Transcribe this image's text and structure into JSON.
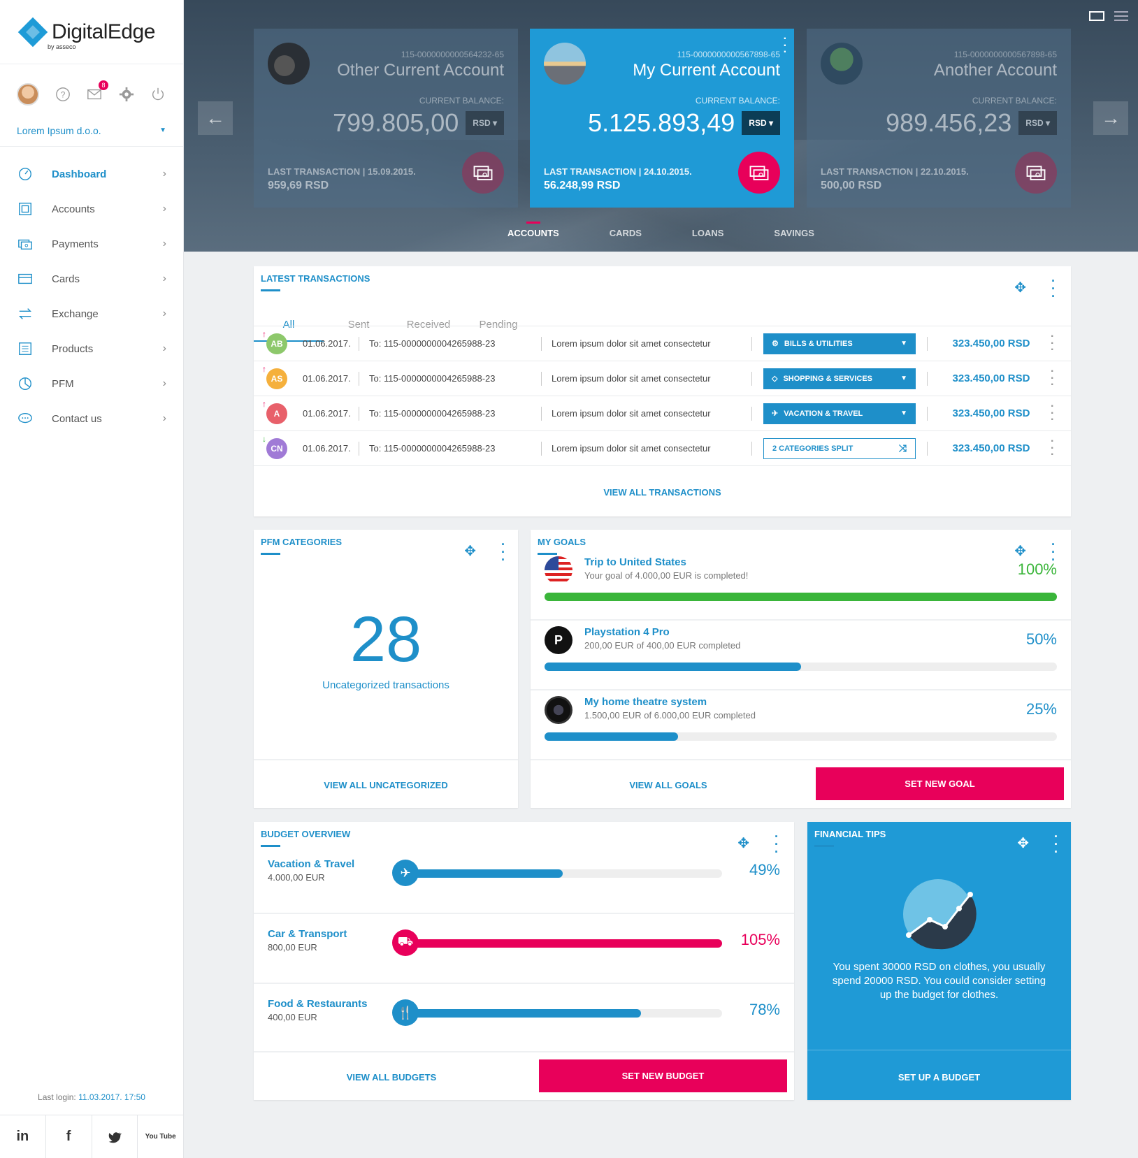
{
  "brand": {
    "name": "DigitalEdge",
    "by": "by asseco"
  },
  "user": {
    "messages_count": "8",
    "company": "Lorem Ipsum d.o.o."
  },
  "nav": [
    {
      "label": "Dashboard",
      "icon": "dashboard-icon"
    },
    {
      "label": "Accounts",
      "icon": "accounts-icon"
    },
    {
      "label": "Payments",
      "icon": "payments-icon"
    },
    {
      "label": "Cards",
      "icon": "cards-icon"
    },
    {
      "label": "Exchange",
      "icon": "exchange-icon"
    },
    {
      "label": "Products",
      "icon": "products-icon"
    },
    {
      "label": "PFM",
      "icon": "pfm-icon"
    },
    {
      "label": "Contact us",
      "icon": "contact-icon"
    }
  ],
  "last_login": {
    "label": "Last login:",
    "value": "11.03.2017. 17:50"
  },
  "social": [
    "in",
    "f",
    "t",
    "You Tube"
  ],
  "accounts": [
    {
      "number": "115-0000000000564232-65",
      "name": "Other Current Account",
      "balance_label": "CURRENT BALANCE:",
      "balance": "799.805,00",
      "currency": "RSD",
      "last_label": "LAST TRANSACTION",
      "last_date": "15.09.2015.",
      "last_amount": "959,69 RSD"
    },
    {
      "number": "115-0000000000567898-65",
      "name": "My Current Account",
      "balance_label": "CURRENT BALANCE:",
      "balance": "5.125.893,49",
      "currency": "RSD",
      "last_label": "LAST TRANSACTION",
      "last_date": "24.10.2015.",
      "last_amount": "56.248,99 RSD"
    },
    {
      "number": "115-0000000000567898-65",
      "name": "Another Account",
      "balance_label": "CURRENT BALANCE:",
      "balance": "989.456,23",
      "currency": "RSD",
      "last_label": "LAST TRANSACTION",
      "last_date": "22.10.2015.",
      "last_amount": "500,00 RSD"
    }
  ],
  "hero_tabs": [
    "ACCOUNTS",
    "CARDS",
    "LOANS",
    "SAVINGS"
  ],
  "transactions": {
    "title": "LATEST TRANSACTIONS",
    "tabs": [
      "All",
      "Sent",
      "Received",
      "Pending"
    ],
    "rows": [
      {
        "initials": "AB",
        "color": "#8dc86b",
        "dir": "↑",
        "date": "01.06.2017.",
        "to": "To: 115-0000000004265988-23",
        "desc": "Lorem ipsum dolor sit amet consectetur",
        "category": "BILLS & UTILITIES",
        "amount": "323.450,00 RSD"
      },
      {
        "initials": "AS",
        "color": "#f5b03c",
        "dir": "↑",
        "date": "01.06.2017.",
        "to": "To: 115-0000000004265988-23",
        "desc": "Lorem ipsum dolor sit amet consectetur",
        "category": "SHOPPING & SERVICES",
        "amount": "323.450,00 RSD"
      },
      {
        "initials": "A",
        "color": "#e8606a",
        "dir": "↑",
        "date": "01.06.2017.",
        "to": "To: 115-0000000004265988-23",
        "desc": "Lorem ipsum dolor sit amet consectetur",
        "category": "VACATION & TRAVEL",
        "amount": "323.450,00 RSD"
      },
      {
        "initials": "CN",
        "color": "#a07ad6",
        "dir": "↓",
        "date": "01.06.2017.",
        "to": "To: 115-0000000004265988-23",
        "desc": "Lorem ipsum dolor sit amet consectetur",
        "category": "2 CATEGORIES SPLIT",
        "amount": "323.450,00 RSD"
      }
    ],
    "view_all": "VIEW ALL TRANSACTIONS"
  },
  "pfm": {
    "title": "PFM CATEGORIES",
    "count": "28",
    "label": "Uncategorized transactions",
    "view_all": "VIEW ALL UNCATEGORIZED"
  },
  "goals": {
    "title": "MY GOALS",
    "items": [
      {
        "name": "Trip to United States",
        "sub": "Your goal of 4.000,00 EUR is completed!",
        "pct": "100%",
        "fill": 1.0,
        "color": "#3ab53a"
      },
      {
        "name": "Playstation 4 Pro",
        "sub": "200,00 EUR of 400,00 EUR completed",
        "pct": "50%",
        "fill": 0.5,
        "color": "#1e8fc9"
      },
      {
        "name": "My home theatre system",
        "sub": "1.500,00 EUR of 6.000,00 EUR completed",
        "pct": "25%",
        "fill": 0.26,
        "color": "#1e8fc9"
      }
    ],
    "view_all": "VIEW ALL GOALS",
    "set_new": "SET NEW GOAL"
  },
  "budget": {
    "title": "BUDGET OVERVIEW",
    "items": [
      {
        "name": "Vacation & Travel",
        "amount": "4.000,00 EUR",
        "pct": "49%",
        "fill": 0.49,
        "color": "#1e8fc9",
        "icon": "plane-icon"
      },
      {
        "name": "Car & Transport",
        "amount": "800,00 EUR",
        "pct": "105%",
        "fill": 1.0,
        "color": "#e8005a",
        "icon": "car-icon"
      },
      {
        "name": "Food & Restaurants",
        "amount": "400,00 EUR",
        "pct": "78%",
        "fill": 0.74,
        "color": "#1e8fc9",
        "icon": "cutlery-icon"
      }
    ],
    "view_all": "VIEW ALL BUDGETS",
    "set_new": "SET NEW BUDGET"
  },
  "tips": {
    "title": "FINANCIAL TIPS",
    "text": "You spent 30000 RSD on clothes, you usually spend 20000 RSD. You could consider setting up the budget for clothes.",
    "action": "SET UP A BUDGET"
  },
  "colors": {
    "accent": "#1e8fc9",
    "primary_card": "#1f9ad6",
    "danger": "#e8005a",
    "success": "#3ab53a"
  }
}
